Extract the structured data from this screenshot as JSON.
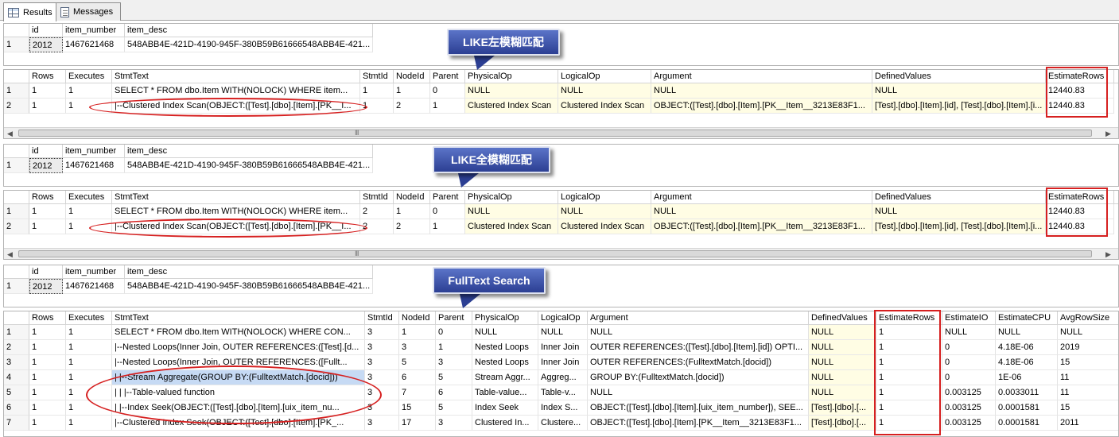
{
  "tabs": [
    {
      "label": "Results",
      "icon": "grid-icon"
    },
    {
      "label": "Messages",
      "icon": "messages-icon"
    }
  ],
  "callouts": [
    "LIKE左模糊匹配",
    "LIKE全模糊匹配",
    "FullText Search"
  ],
  "item_result": {
    "headers": [
      "id",
      "item_number",
      "item_desc"
    ],
    "row": {
      "n": "1",
      "id": "2012",
      "item_number": "1467621468",
      "item_desc": "548ABB4E-421D-4190-945F-380B59B61666548ABB4E-421..."
    }
  },
  "plan_headers": [
    "Rows",
    "Executes",
    "StmtText",
    "StmtId",
    "NodeId",
    "Parent",
    "PhysicalOp",
    "LogicalOp",
    "Argument",
    "DefinedValues",
    "EstimateRows"
  ],
  "plan1": [
    [
      "1",
      "1",
      "1",
      "SELECT *  FROM dbo.Item WITH(NOLOCK)  WHERE item...",
      "1",
      "1",
      "0",
      "NULL",
      "NULL",
      "NULL",
      "NULL",
      "12440.83"
    ],
    [
      "2",
      "1",
      "1",
      "|--Clustered Index Scan(OBJECT:([Test].[dbo].[Item].[PK__I...",
      "1",
      "2",
      "1",
      "Clustered Index Scan",
      "Clustered Index Scan",
      "OBJECT:([Test].[dbo].[Item].[PK__Item__3213E83F1...",
      "[Test].[dbo].[Item].[id], [Test].[dbo].[Item].[i...",
      "12440.83"
    ]
  ],
  "plan2": [
    [
      "1",
      "1",
      "1",
      "SELECT *  FROM dbo.Item WITH(NOLOCK)  WHERE item...",
      "2",
      "1",
      "0",
      "NULL",
      "NULL",
      "NULL",
      "NULL",
      "12440.83"
    ],
    [
      "2",
      "1",
      "1",
      "|--Clustered Index Scan(OBJECT:([Test].[dbo].[Item].[PK__I...",
      "2",
      "2",
      "1",
      "Clustered Index Scan",
      "Clustered Index Scan",
      "OBJECT:([Test].[dbo].[Item].[PK__Item__3213E83F1...",
      "[Test].[dbo].[Item].[id], [Test].[dbo].[Item].[i...",
      "12440.83"
    ]
  ],
  "plan3_headers": [
    "Rows",
    "Executes",
    "StmtText",
    "StmtId",
    "NodeId",
    "Parent",
    "PhysicalOp",
    "LogicalOp",
    "Argument",
    "DefinedValues",
    "EstimateRows",
    "EstimateIO",
    "EstimateCPU",
    "AvgRowSize"
  ],
  "plan3": [
    [
      "1",
      "1",
      "1",
      "SELECT *   FROM dbo.Item WITH(NOLOCK)  WHERE CON...",
      "3",
      "1",
      "0",
      "NULL",
      "NULL",
      "NULL",
      "NULL",
      "1",
      "NULL",
      "NULL",
      "NULL"
    ],
    [
      "2",
      "1",
      "1",
      "|--Nested Loops(Inner Join, OUTER REFERENCES:([Test].[d...",
      "3",
      "3",
      "1",
      "Nested Loops",
      "Inner Join",
      "OUTER REFERENCES:([Test].[dbo].[Item].[id]) OPTI...",
      "NULL",
      "1",
      "0",
      "4.18E-06",
      "2019"
    ],
    [
      "3",
      "1",
      "1",
      "|--Nested Loops(Inner Join, OUTER REFERENCES:([Fullt...",
      "3",
      "5",
      "3",
      "Nested Loops",
      "Inner Join",
      "OUTER REFERENCES:(FulltextMatch.[docid])",
      "NULL",
      "1",
      "0",
      "4.18E-06",
      "15"
    ],
    [
      "4",
      "1",
      "1",
      "|    |--Stream Aggregate(GROUP BY:(FulltextMatch.[docid]))",
      "3",
      "6",
      "5",
      "Stream Aggr...",
      "Aggreg...",
      "GROUP BY:(FulltextMatch.[docid])",
      "NULL",
      "1",
      "0",
      "1E-06",
      "11"
    ],
    [
      "5",
      "1",
      "1",
      "|    |    |--Table-valued function",
      "3",
      "7",
      "6",
      "Table-value...",
      "Table-v...",
      "NULL",
      "NULL",
      "1",
      "0.003125",
      "0.0033011",
      "11"
    ],
    [
      "6",
      "1",
      "1",
      "|    |--Index Seek(OBJECT:([Test].[dbo].[Item].[uix_item_nu...",
      "3",
      "15",
      "5",
      "Index Seek",
      "Index S...",
      "OBJECT:([Test].[dbo].[Item].[uix_item_number]), SEE...",
      "[Test].[dbo].[...",
      "1",
      "0.003125",
      "0.0001581",
      "15"
    ],
    [
      "7",
      "1",
      "1",
      "|--Clustered Index Seek(OBJECT:([Test].[dbo].[Item].[PK_...",
      "3",
      "17",
      "3",
      "Clustered In...",
      "Clustere...",
      "OBJECT:([Test].[dbo].[Item].[PK__Item__3213E83F1...",
      "[Test].[dbo].[...",
      "1",
      "0.003125",
      "0.0001581",
      "2011"
    ]
  ],
  "scroll_grip": "III",
  "colors": {
    "annotation_red": "#d62020",
    "callout_blue": "#2c3f93",
    "highlight_yellow": "#fffde4"
  }
}
